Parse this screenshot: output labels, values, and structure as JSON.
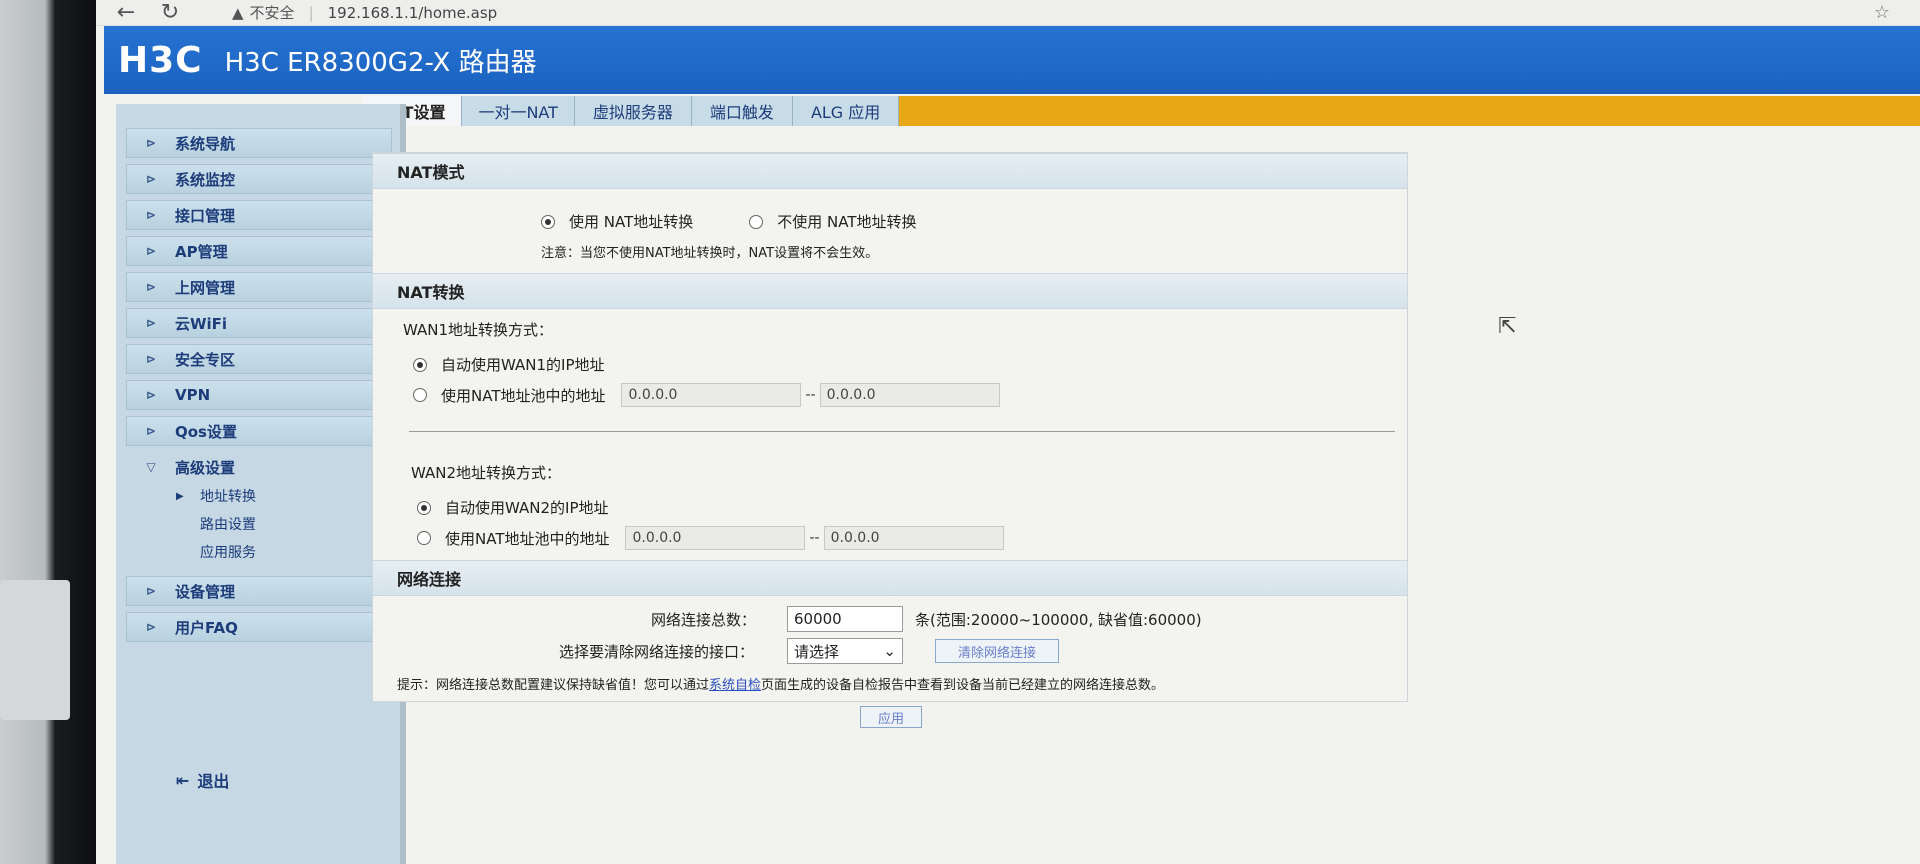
{
  "browser": {
    "back": "←",
    "reload": "↻",
    "security_icon": "warning-icon",
    "security_text": "不安全",
    "url": "192.168.1.1/home.asp",
    "star": "☆"
  },
  "header": {
    "logo": "H3C",
    "product": "H3C ER8300G2-X 路由器",
    "color": "#1b62c0"
  },
  "sidebar": {
    "items": [
      {
        "label": "系统导航"
      },
      {
        "label": "系统监控"
      },
      {
        "label": "接口管理"
      },
      {
        "label": "AP管理"
      },
      {
        "label": "上网管理"
      },
      {
        "label": "云WiFi"
      },
      {
        "label": "安全专区"
      },
      {
        "label": "VPN"
      },
      {
        "label": "Qos设置"
      },
      {
        "label": "高级设置"
      }
    ],
    "sub_items": [
      {
        "label": "地址转换",
        "selected": true
      },
      {
        "label": "路由设置"
      },
      {
        "label": "应用服务"
      }
    ],
    "bottom_items": [
      {
        "label": "设备管理"
      },
      {
        "label": "用户FAQ"
      }
    ],
    "logout": "退出"
  },
  "tabs": [
    {
      "label": "NAT设置",
      "active": true
    },
    {
      "label": "一对一NAT"
    },
    {
      "label": "虚拟服务器"
    },
    {
      "label": "端口触发"
    },
    {
      "label": "ALG 应用"
    }
  ],
  "nat_mode": {
    "title": "NAT模式",
    "option_use": "使用 NAT地址转换",
    "option_nouse": "不使用 NAT地址转换",
    "selected": "use",
    "note": "注意：当您不使用NAT地址转换时，NAT设置将不会生效。"
  },
  "nat_conversion": {
    "title": "NAT转换",
    "wan1": {
      "label": "WAN1地址转换方式：",
      "auto": "自动使用WAN1的IP地址",
      "pool": "使用NAT地址池中的地址",
      "pool_start": "0.0.0.0",
      "pool_end": "0.0.0.0",
      "selected": "auto"
    },
    "wan2": {
      "label": "WAN2地址转换方式：",
      "auto": "自动使用WAN2的IP地址",
      "pool": "使用NAT地址池中的地址",
      "pool_start": "0.0.0.0",
      "pool_end": "0.0.0.0",
      "selected": "auto"
    },
    "dash": "--"
  },
  "network": {
    "title": "网络连接",
    "total_label": "网络连接总数：",
    "total_value": "60000",
    "range_text": "条(范围:20000~100000, 缺省值:60000)",
    "clear_label": "选择要清除网络连接的接口：",
    "select_value": "请选择",
    "clear_button": "清除网络连接",
    "tip_prefix": "提示：网络连接总数配置建议保持缺省值！您可以通过",
    "tip_link": "系统自检",
    "tip_suffix": "页面生成的设备自检报告中查看到设备当前已经建立的网络连接总数。"
  },
  "apply_button": "应用"
}
